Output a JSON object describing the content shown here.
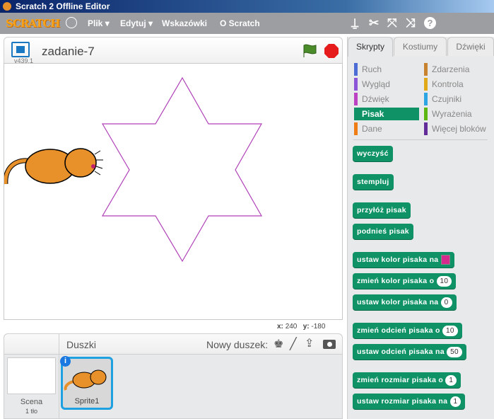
{
  "window": {
    "title": "Scratch 2 Offline Editor"
  },
  "menubar": {
    "logo": "SCRATCH",
    "items": [
      "Plik",
      "Edytuj",
      "Wskazówki",
      "O Scratch"
    ],
    "tools": [
      "stamp-icon",
      "cut-icon",
      "grow-icon",
      "shrink-icon",
      "help-icon"
    ]
  },
  "stage": {
    "project_title": "zadanie-7",
    "version": "v439.1",
    "x_label": "x:",
    "x_value": "240",
    "y_label": "y:",
    "y_value": "-180",
    "pen_color": "#b040b8"
  },
  "tabs": [
    "Skrypty",
    "Kostiumy",
    "Dźwięki"
  ],
  "categories": [
    {
      "label": "Ruch",
      "color": "#4a6cd4"
    },
    {
      "label": "Zdarzenia",
      "color": "#c88330"
    },
    {
      "label": "Wygląd",
      "color": "#8a55d7"
    },
    {
      "label": "Kontrola",
      "color": "#e1a91a"
    },
    {
      "label": "Dźwięk",
      "color": "#bb42c3"
    },
    {
      "label": "Czujniki",
      "color": "#2ca5e2"
    },
    {
      "label": "Pisak",
      "color": "#0e9a6c",
      "selected": true
    },
    {
      "label": "Wyrażenia",
      "color": "#5cb712"
    },
    {
      "label": "Dane",
      "color": "#ee7d16"
    },
    {
      "label": "Więcej bloków",
      "color": "#632d99"
    }
  ],
  "blocks": [
    {
      "text": "wyczyść"
    },
    {
      "text": "stempluj"
    },
    {
      "text": "przyłóż pisak"
    },
    {
      "text": "podnieś pisak"
    },
    {
      "text": "ustaw kolor pisaka na",
      "swatch": "#d62a8c"
    },
    {
      "text": "zmień kolor pisaka o",
      "value": "10"
    },
    {
      "text": "ustaw kolor pisaka na",
      "value": "0"
    },
    {
      "text": "zmień odcień pisaka o",
      "value": "10"
    },
    {
      "text": "ustaw odcień pisaka na",
      "value": "50"
    },
    {
      "text": "zmień rozmiar pisaka o",
      "value": "1"
    },
    {
      "text": "ustaw rozmiar pisaka na",
      "value": "1"
    }
  ],
  "sprites": {
    "header": "Duszki",
    "new_sprite_label": "Nowy duszek:",
    "scene_label": "Scena",
    "scene_sub": "1 tło",
    "items": [
      {
        "name": "Sprite1"
      }
    ]
  }
}
